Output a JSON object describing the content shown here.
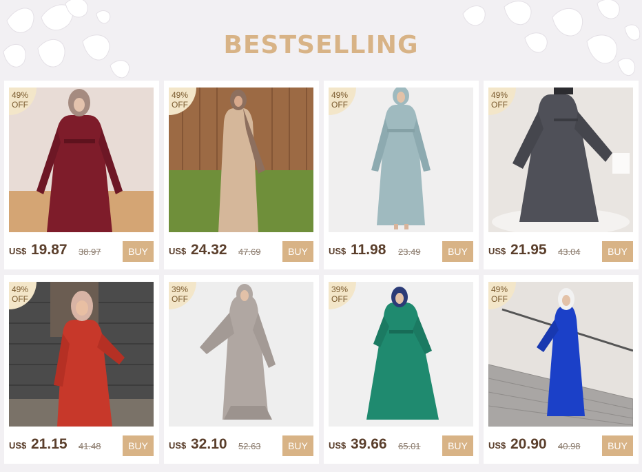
{
  "title": "BESTSELLING",
  "products": [
    {
      "discount": "49%",
      "off": "OFF",
      "currency": "US$",
      "price": "19.87",
      "old_price": "38.97",
      "buy": "BUY",
      "dress_color": "#7e1c2a",
      "hijab_color": "#a58b80",
      "bg": "#e8dcd6",
      "floor": "#d4a574"
    },
    {
      "discount": "49%",
      "off": "OFF",
      "currency": "US$",
      "price": "24.32",
      "old_price": "47.69",
      "buy": "BUY",
      "dress_color": "#d5b79a",
      "hijab_color": "#8d6f5e",
      "bg": "#9c6a44",
      "floor": "#6f8f3a"
    },
    {
      "discount": "49%",
      "off": "OFF",
      "currency": "US$",
      "price": "11.98",
      "old_price": "23.49",
      "buy": "BUY",
      "dress_color": "#9fbabf",
      "hijab_color": "#9fbabf",
      "bg": "#f0efef",
      "floor": "#f0efef"
    },
    {
      "discount": "49%",
      "off": "OFF",
      "currency": "US$",
      "price": "21.95",
      "old_price": "43.04",
      "buy": "BUY",
      "dress_color": "#4f5058",
      "hijab_color": "#2c2c30",
      "bg": "#e9e5e1",
      "floor": "#f4f2f0"
    },
    {
      "discount": "49%",
      "off": "OFF",
      "currency": "US$",
      "price": "21.15",
      "old_price": "41.48",
      "buy": "BUY",
      "dress_color": "#c7382a",
      "hijab_color": "#d8b4a5",
      "bg": "#4b4b4b",
      "floor": "#7a7268"
    },
    {
      "discount": "39%",
      "off": "OFF",
      "currency": "US$",
      "price": "32.10",
      "old_price": "52.63",
      "buy": "BUY",
      "dress_color": "#b0a7a2",
      "hijab_color": "#b0a7a2",
      "bg": "#eeeeee",
      "floor": "#eeeeee"
    },
    {
      "discount": "39%",
      "off": "OFF",
      "currency": "US$",
      "price": "39.66",
      "old_price": "65.01",
      "buy": "BUY",
      "dress_color": "#1f8a6f",
      "hijab_color": "#2b3b77",
      "bg": "#f0f0f0",
      "floor": "#f0f0f0"
    },
    {
      "discount": "49%",
      "off": "OFF",
      "currency": "US$",
      "price": "20.90",
      "old_price": "40.98",
      "buy": "BUY",
      "dress_color": "#1b40c8",
      "hijab_color": "#f2f2f2",
      "bg": "#e6e2de",
      "floor": "#a9a6a4"
    }
  ]
}
